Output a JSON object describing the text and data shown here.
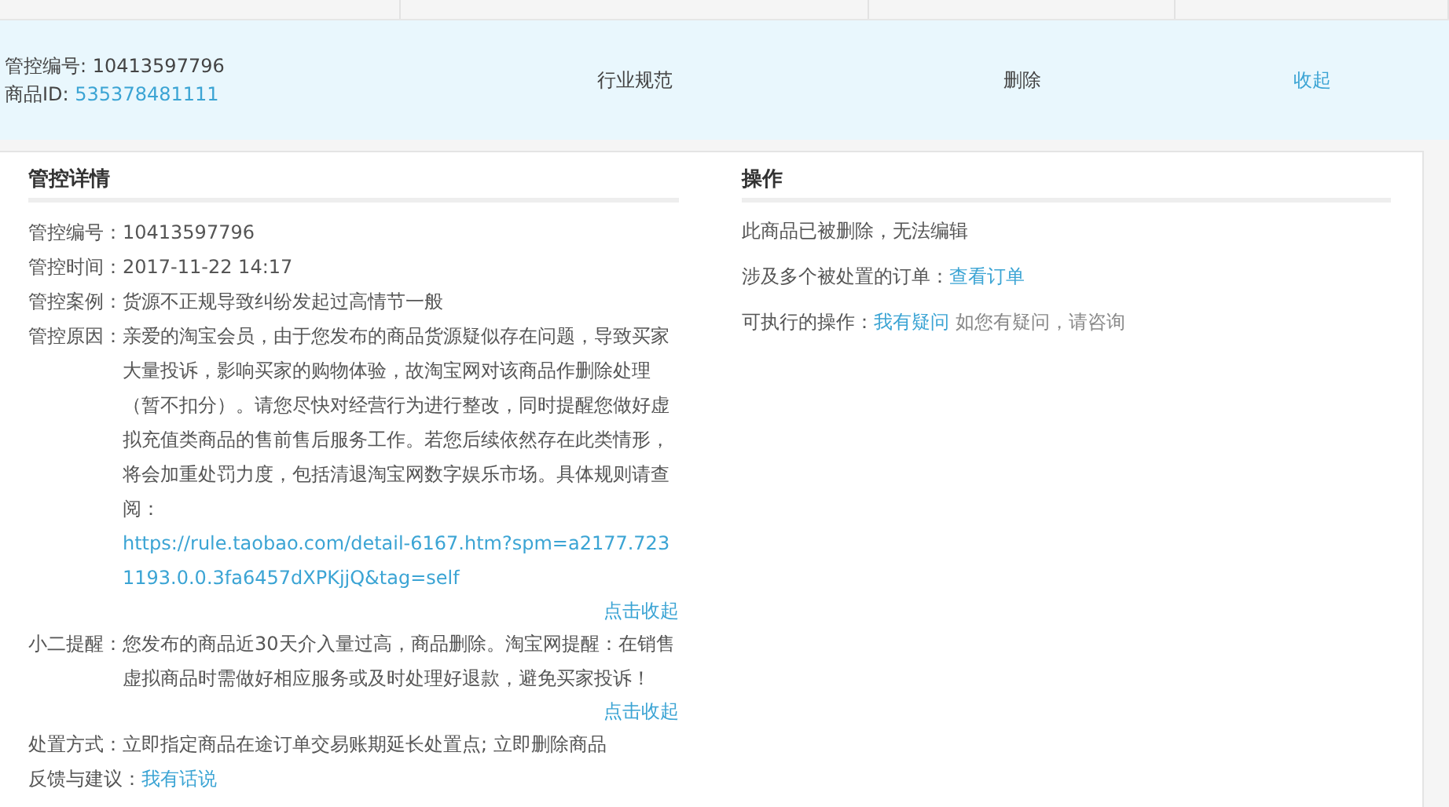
{
  "record_row": {
    "control_no_label": "管控编号:",
    "control_no": "10413597796",
    "item_id_label": "商品ID:",
    "item_id": "535378481111",
    "category": "行业规范",
    "action": "删除",
    "toggle": "收起"
  },
  "details": {
    "title": "管控详情",
    "fields": [
      {
        "label": "管控编号：",
        "value": "10413597796"
      },
      {
        "label": "管控时间：",
        "value": "2017-11-22 14:17"
      },
      {
        "label": "管控案例：",
        "value": "货源不正规导致纠纷发起过高情节一般"
      },
      {
        "label": "管控原因：",
        "value": "亲爱的淘宝会员，由于您发布的商品货源疑似存在问题，导致买家大量投诉，影响买家的购物体验，故淘宝网对该商品作删除处理（暂不扣分）。请您尽快对经营行为进行整改，同时提醒您做好虚拟充值类商品的售前售后服务工作。若您后续依然存在此类情形，将会加重处罚力度，包括清退淘宝网数字娱乐市场。具体规则请查阅：",
        "link": "https://rule.taobao.com/detail-6167.htm?spm=a2177.7231193.0.0.3fa6457dXPKjjQ&tag=self",
        "collapse": "点击收起"
      },
      {
        "label": "小二提醒：",
        "value": "您发布的商品近30天介入量过高，商品删除。淘宝网提醒：在销售虚拟商品时需做好相应服务或及时处理好退款，避免买家投诉！",
        "collapse": "点击收起"
      },
      {
        "label": "处置方式：",
        "value": "立即指定商品在途订单交易账期延长处置点; 立即删除商品"
      },
      {
        "label": "反馈与建议：",
        "link": "我有话说"
      }
    ]
  },
  "operations": {
    "title": "操作",
    "lines": [
      {
        "text": "此商品已被删除，无法编辑"
      },
      {
        "text": "涉及多个被处置的订单：",
        "link": "查看订单"
      },
      {
        "text": "可执行的操作：",
        "link": "我有疑问",
        "note": "如您有疑问，请咨询"
      }
    ]
  }
}
